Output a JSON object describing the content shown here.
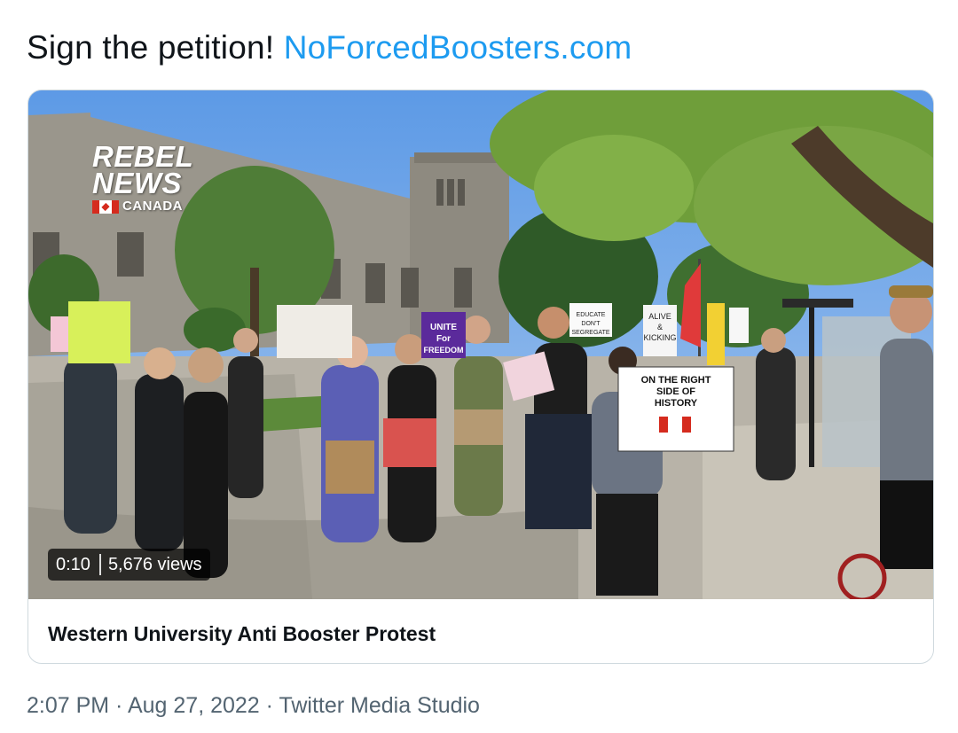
{
  "tweet": {
    "text_prefix": "Sign the petition! ",
    "link_text": "NoForcedBoosters.com"
  },
  "media": {
    "watermark": {
      "line1": "REBEL",
      "line2": "NEWS",
      "line3": "CANADA"
    },
    "signs": [
      "UNITE For FREEDOM",
      "ALIVE & KICKING",
      "ON THE RIGHT SIDE OF HISTORY",
      "EDUCATE DON'T SEGREGATE"
    ],
    "duration": "0:10",
    "views": "5,676 views"
  },
  "card": {
    "title": "Western University Anti Booster Protest"
  },
  "meta": {
    "time": "2:07 PM",
    "date": "Aug 27, 2022",
    "source": "Twitter Media Studio",
    "separator": " · "
  },
  "colors": {
    "link": "#1d9bf0",
    "meta_text": "#536471",
    "card_border": "#cfd9de"
  }
}
